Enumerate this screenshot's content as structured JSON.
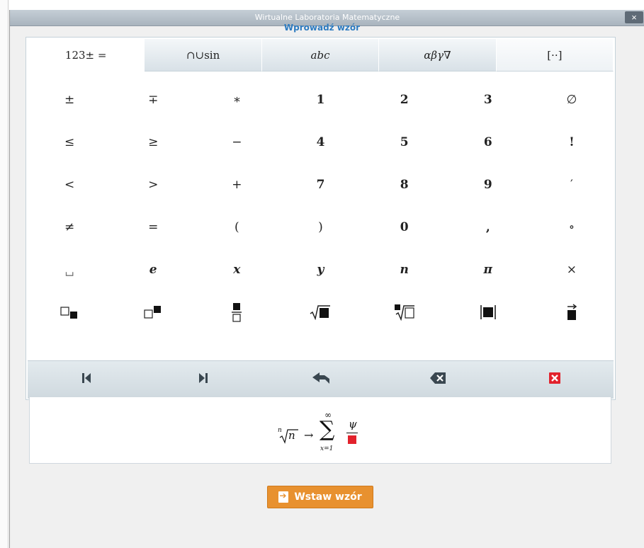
{
  "window": {
    "title": "Wirtualne Laboratoria Matematyczne",
    "close_label": "×"
  },
  "heading": "Wprowadź wzór",
  "tabs": [
    {
      "label": "123± ="
    },
    {
      "label": "∩∪sin"
    },
    {
      "label": "abc"
    },
    {
      "label": "αβγ∇"
    },
    {
      "label": "[··]"
    }
  ],
  "keys": {
    "row1": [
      "±",
      "∓",
      "∗",
      "1",
      "2",
      "3",
      "∅"
    ],
    "row2": [
      "≤",
      "≥",
      "−",
      "4",
      "5",
      "6",
      "!"
    ],
    "row3": [
      "<",
      ">",
      "+",
      "7",
      "8",
      "9",
      "′"
    ],
    "row4": [
      "≠",
      "=",
      "(",
      ")",
      "0",
      ",",
      "∘"
    ],
    "row5": [
      "␣",
      "e",
      "x",
      "y",
      "n",
      "π",
      "×"
    ]
  },
  "template_icons": [
    "subscript-template-icon",
    "superscript-template-icon",
    "fraction-template-icon",
    "sqrt-template-icon",
    "nth-root-template-icon",
    "abs-template-icon",
    "vector-template-icon"
  ],
  "nav_icons": [
    "cursor-start-icon",
    "cursor-end-icon",
    "undo-icon",
    "backspace-icon",
    "clear-icon"
  ],
  "formula": {
    "root_index": "n",
    "radicand": "n",
    "arrow": "→",
    "sum_upper": "∞",
    "sum_lower": "x=1",
    "numerator": "ψ"
  },
  "insert_button": "Wstaw wzór",
  "colors": {
    "accent": "#2d7bc0",
    "button": "#e8912f",
    "clear": "#e2222c",
    "placeholder": "#e2222c"
  }
}
